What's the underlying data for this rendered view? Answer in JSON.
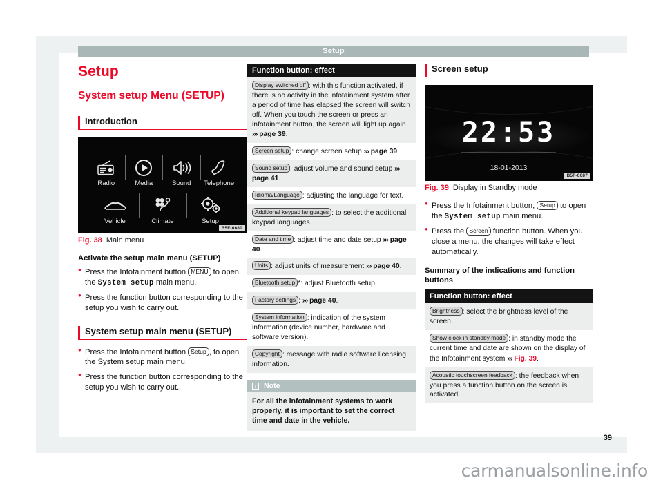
{
  "running_head": "Setup",
  "page_number": "39",
  "watermark": "carmanualsonline.info",
  "colors": {
    "accent_red": "#ec0928",
    "head_bar": "#a9b7b7",
    "table_head": "#131313",
    "note_head": "#b3c0c0"
  },
  "col1": {
    "title": "Setup",
    "subtitle": "System setup Menu (SETUP)",
    "section_intro": "Introduction",
    "figure": {
      "code": "B5F-0680",
      "fig_num": "Fig. 38",
      "caption": "Main menu",
      "menu_row1": [
        {
          "label": "Radio",
          "icon": "radio-icon"
        },
        {
          "label": "Media",
          "icon": "play-circle-icon"
        },
        {
          "label": "Sound",
          "icon": "speaker-icon"
        },
        {
          "label": "Telephone",
          "icon": "phone-handset-icon"
        }
      ],
      "menu_row2": [
        {
          "label": "Vehicle",
          "icon": "car-icon"
        },
        {
          "label": "Climate",
          "icon": "climate-fan-icon"
        },
        {
          "label": "Setup",
          "icon": "gears-icon"
        }
      ]
    },
    "heading_activate": "Activate the setup main menu (SETUP)",
    "b1_pre": "Press the Infotainment button ",
    "b1_key": "MENU",
    "b1_mid": " to open the ",
    "b1_mono": "System setup",
    "b1_post": " main menu.",
    "b2": "Press the function button corresponding to the setup you wish to carry out.",
    "section_mainmenu": "System setup main menu (SETUP)",
    "b3_pre": "Press the Infotainment button ",
    "b3_key": "Setup",
    "b3_post": ", to open the System setup main menu.",
    "b4": "Press the function button corresponding to the setup you wish to carry out."
  },
  "col2": {
    "table_head": "Function button: effect",
    "rows": [
      {
        "key": "Display switched off",
        "text": ": with this function activated, if there is no activity in the infotainment system after a period of time has elapsed the screen will switch off. When you touch the screen or press an infotainment button, the screen will light up again ",
        "ref": "page 39",
        "tail": "."
      },
      {
        "key": "Screen setup",
        "text": ": change screen setup ",
        "ref": "page 39",
        "tail": "."
      },
      {
        "key": "Sound setup",
        "text": ": adjust volume and sound setup ",
        "ref": "page 41",
        "tail": "."
      },
      {
        "key": "Idioma/Language",
        "text": ": adjusting the language for text.",
        "ref": "",
        "tail": ""
      },
      {
        "key": "Additional keypad languages",
        "text": ": to select the additional keypad languages.",
        "ref": "",
        "tail": ""
      },
      {
        "key": "Date and time",
        "text": ": adjust time and date setup ",
        "ref": "page 40",
        "tail": "."
      },
      {
        "key": "Units",
        "text": ": adjust units of measurement ",
        "ref": "page 40",
        "tail": "."
      },
      {
        "key": "Bluetooth setup",
        "text": "*: adjust Bluetooth setup",
        "ref": "",
        "tail": ""
      },
      {
        "key": "Factory settings",
        "text": ": ",
        "ref": "page 40",
        "tail": "."
      },
      {
        "key": "System information",
        "text": ": indication of the system information (device number, hardware and software version).",
        "ref": "",
        "tail": ""
      },
      {
        "key": "Copyright",
        "text": ": message with radio software licensing information.",
        "ref": "",
        "tail": ""
      }
    ],
    "note": {
      "icon": "info-icon",
      "title": "Note",
      "body": "For all the infotainment systems to work properly, it is important to set the correct time and date in the vehicle."
    }
  },
  "col3": {
    "section_screen_setup": "Screen setup",
    "figure": {
      "code": "B5F-0687",
      "fig_num": "Fig. 39",
      "caption": "Display in Standby mode",
      "time": "22:53",
      "date": "18-01-2013"
    },
    "b1_pre": "Press the Infotainment button, ",
    "b1_key": "Setup",
    "b1_mid": " to open the ",
    "b1_mono": "System setup",
    "b1_post": " main menu.",
    "b2_pre": "Press the ",
    "b2_key": "Screen",
    "b2_post": " function button. When you close a menu, the changes will take effect automatically.",
    "heading_summary": "Summary of the indications and function buttons",
    "table_head": "Function button: effect",
    "rows": [
      {
        "key": "Brightness",
        "text": ": select the brightness level of the screen.",
        "ref": "",
        "tail": ""
      },
      {
        "key": "Show clock in standby mode",
        "text": ": in standby mode the current time and date are shown on the display of the Infotainment system ",
        "ref": "Fig. 39",
        "tail": "."
      },
      {
        "key": "Acoustic touchscreen feedback",
        "text": ": the feedback when you press a function button on the screen is activated.",
        "ref": "",
        "tail": ""
      }
    ]
  }
}
